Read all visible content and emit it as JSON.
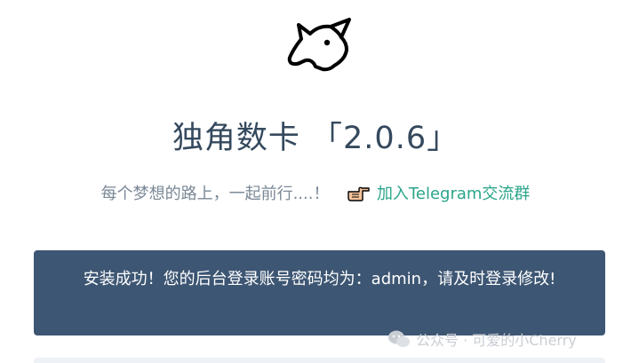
{
  "header": {
    "logo_icon": "unicorn-head-icon",
    "title": "独角数卡 「2.0.6」",
    "slogan": "每个梦想的路上，一起前行....！",
    "hand_icon": "pointing-hand-icon",
    "telegram_link": "加入Telegram交流群"
  },
  "alert": {
    "message": "安装成功！您的后台登录账号密码均为：admin，请及时登录修改!"
  },
  "watermark": {
    "icon": "wechat-icon",
    "text": "公众号 · 可爱的小Cherry"
  },
  "colors": {
    "title": "#35495e",
    "slogan": "#7a8896",
    "link": "#2aa58a",
    "alert_bg": "#3d5673"
  }
}
